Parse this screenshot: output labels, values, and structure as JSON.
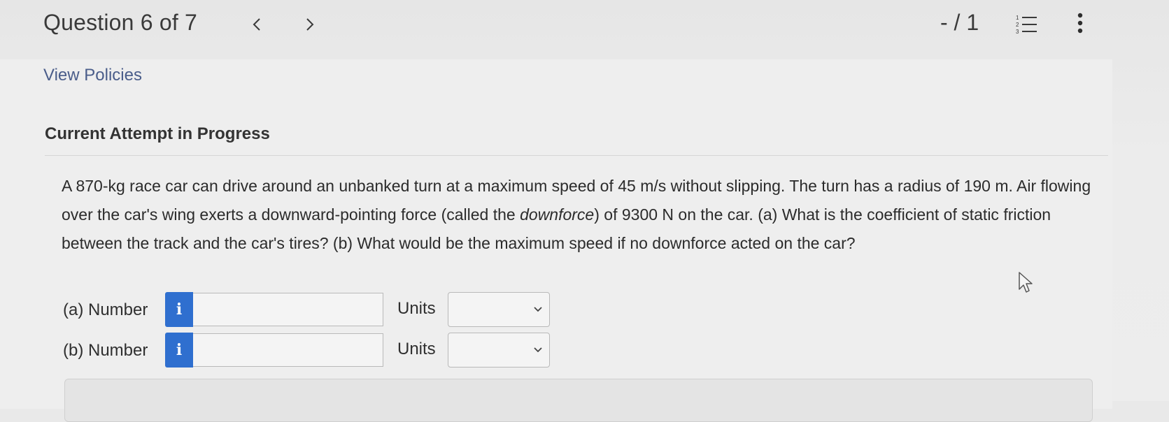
{
  "header": {
    "question_label": "Question 6 of 7",
    "score": "- / 1",
    "prev_icon": "chevron-left-icon",
    "next_icon": "chevron-right-icon",
    "list_icon": "numbered-list-icon",
    "more_icon": "vertical-dots-icon"
  },
  "links": {
    "view_policies": "View Policies"
  },
  "section": {
    "attempt_heading": "Current Attempt in Progress"
  },
  "problem": {
    "text_before_em": "A 870-kg race car can drive around an unbanked turn at a maximum speed of 45 m/s without slipping. The turn has a radius of 190 m. Air flowing over the car's wing exerts a downward-pointing force (called the ",
    "em_text": "downforce",
    "text_after_em": ") of 9300 N on the car. (a) What is the coefficient of static friction between the track and the car's tires? (b) What would be the maximum speed if no downforce acted on the car?"
  },
  "answers": [
    {
      "label": "(a) Number",
      "info_glyph": "i",
      "value": "",
      "units_label": "Units",
      "units_selected": ""
    },
    {
      "label": "(b) Number",
      "info_glyph": "i",
      "value": "",
      "units_label": "Units",
      "units_selected": ""
    }
  ],
  "colors": {
    "info_button": "#2f6fcf",
    "link": "#4a5d8a",
    "background": "#eeeeee"
  }
}
